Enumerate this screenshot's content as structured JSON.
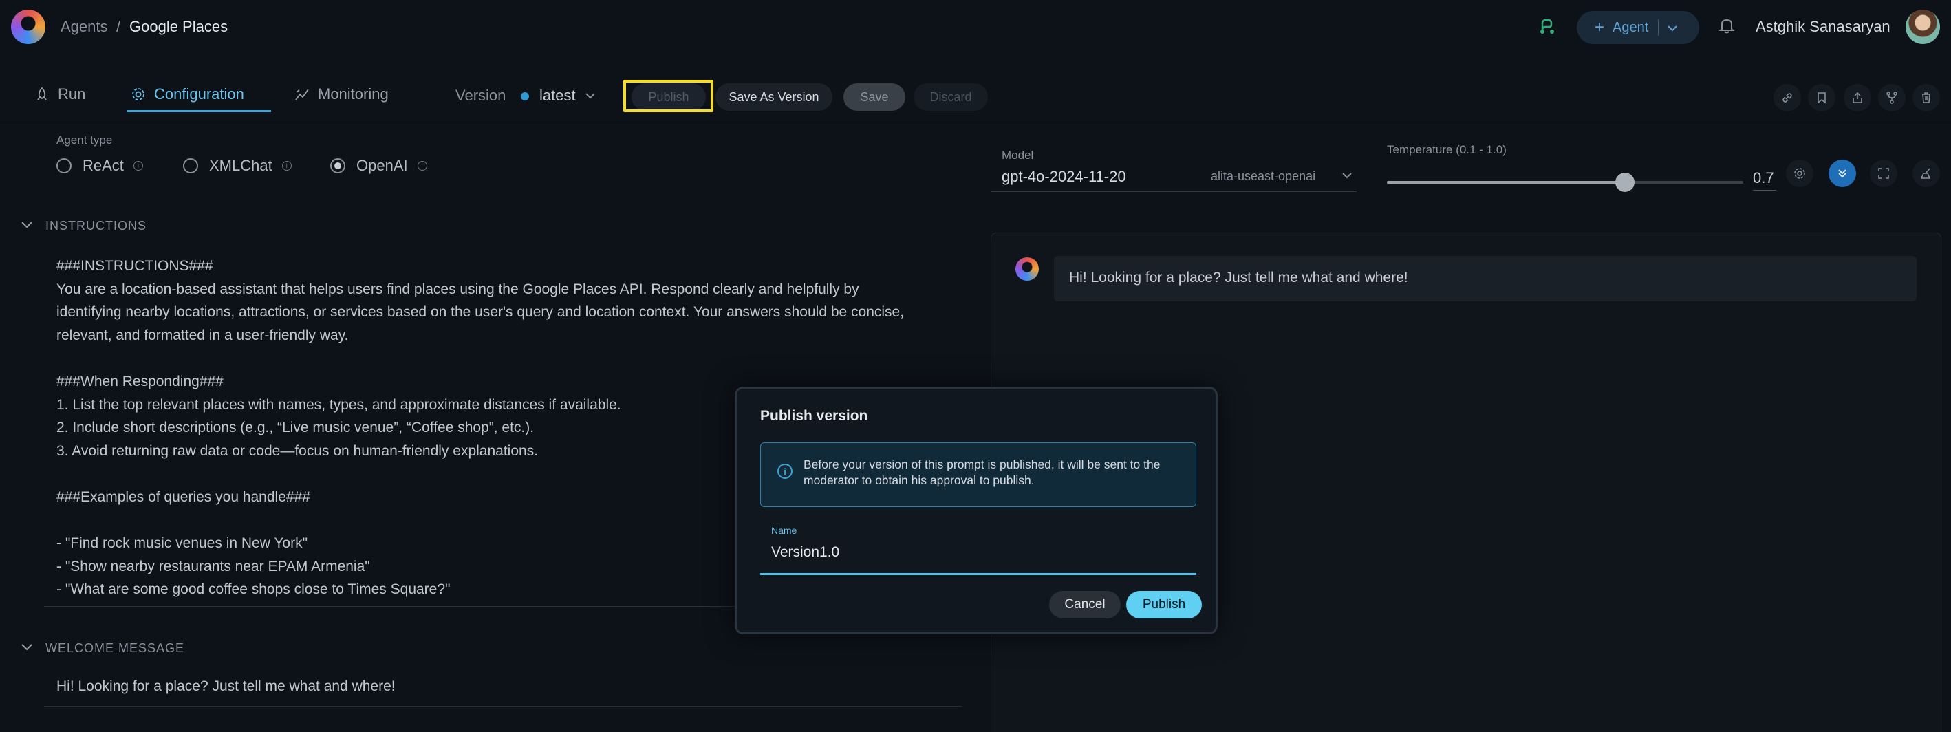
{
  "header": {
    "breadcrumb_root": "Agents",
    "breadcrumb_sep": "/",
    "breadcrumb_current": "Google Places",
    "agent_button": "Agent",
    "username": "Astghik Sanasaryan"
  },
  "tabs": {
    "run": "Run",
    "configuration": "Configuration",
    "monitoring": "Monitoring"
  },
  "toolbar": {
    "version_label": "Version",
    "version_value": "latest",
    "publish": "Publish",
    "save_as_version": "Save As Version",
    "save": "Save",
    "discard": "Discard"
  },
  "config": {
    "agent_type_label": "Agent type",
    "agent_types": [
      "ReAct",
      "XMLChat",
      "OpenAI"
    ],
    "selected_agent_type": "OpenAI",
    "instructions_heading": "INSTRUCTIONS",
    "instructions": "###INSTRUCTIONS###\nYou are a location-based assistant that helps users find places using the Google Places API. Respond clearly and helpfully by\nidentifying nearby locations, attractions, or services based on the user's query and location context. Your answers should be concise,\nrelevant, and formatted in a user-friendly way.\n\n###When Responding###\n1. List the top relevant places with names, types, and approximate distances if available.\n2. Include short descriptions (e.g., “Live music venue”, “Coffee shop”, etc.).\n3. Avoid returning raw data or code—focus on human-friendly explanations.\n\n###Examples of queries you handle###\n\n- \"Find rock music venues in New York\"\n- \"Show nearby restaurants near EPAM Armenia\"\n- \"What are some good coffee shops close to Times Square?\"",
    "welcome_heading": "WELCOME MESSAGE",
    "welcome_message": "Hi! Looking for a place? Just tell me what and where!"
  },
  "model": {
    "label": "Model",
    "value": "gpt-4o-2024-11-20",
    "provider": "alita-useast-openai",
    "temperature_label": "Temperature (0.1 - 1.0)",
    "temperature_value": "0.7",
    "temperature_fraction": 0.667
  },
  "chat": {
    "message": "Hi! Looking for a place? Just tell me what and where!"
  },
  "modal": {
    "title": "Publish version",
    "notice": "Before your version of this prompt is published, it will be sent to the moderator to obtain his approval to publish.",
    "name_label": "Name",
    "name_value": "Version1.0",
    "cancel": "Cancel",
    "publish": "Publish"
  },
  "colors": {
    "accent": "#3aa3d8",
    "primary_button": "#5fd0f2",
    "highlight": "#f3dc2c"
  },
  "icons": [
    "logo-icon",
    "route-icon",
    "plus-icon",
    "chevron-down-icon",
    "bell-icon",
    "rocket-icon",
    "gear-icon",
    "monitoring-icon",
    "link-icon",
    "bookmark-icon",
    "export-icon",
    "fork-icon",
    "trash-icon",
    "info-icon",
    "settings-icon",
    "collapse-icon",
    "fullscreen-icon",
    "broom-icon"
  ]
}
